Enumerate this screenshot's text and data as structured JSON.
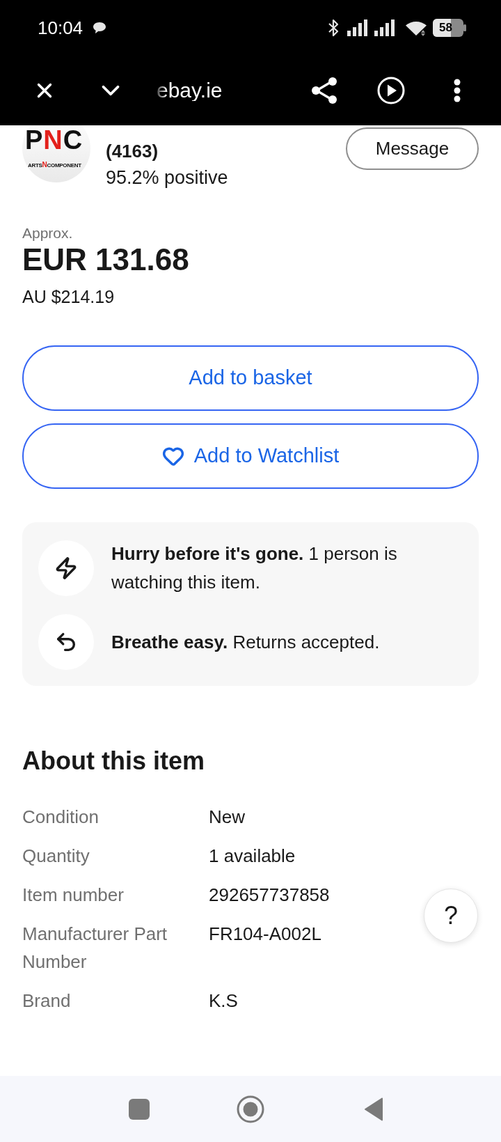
{
  "status_bar": {
    "time": "10:04",
    "battery": "58"
  },
  "browser_toolbar": {
    "url": "ebay.ie"
  },
  "seller": {
    "logo": {
      "letters": [
        {
          "text": "P",
          "color": "#111111"
        },
        {
          "text": "N",
          "color": "#e3201b"
        },
        {
          "text": "C",
          "color": "#111111"
        }
      ],
      "tagline": [
        {
          "text": "ARTS",
          "color": "#111111"
        },
        {
          "text": "N",
          "color": "#e3201b"
        },
        {
          "text": "COMPONENT",
          "color": "#111111"
        }
      ]
    },
    "feedback_count": "(4163)",
    "positive_rating": "95.2% positive",
    "message_button": "Message"
  },
  "price": {
    "note": "Approx.",
    "amount": "EUR 131.68",
    "converted": "AU $214.19"
  },
  "actions": [
    {
      "kind": "basket",
      "label": "Add to basket"
    },
    {
      "kind": "watchlist",
      "label": "Add to Watchlist"
    }
  ],
  "highlights": [
    {
      "kind": "lightning",
      "text": "**Hurry before it's gone.** 1 person is watching this item."
    },
    {
      "kind": "returns",
      "text": "**Breathe easy.** Returns accepted."
    }
  ],
  "about": {
    "title": "About this item",
    "rows": [
      {
        "label": "Condition",
        "value": "New"
      },
      {
        "label": "Quantity",
        "value": "1 available"
      },
      {
        "label": "Item number",
        "value": "292657737858"
      },
      {
        "label": "Manufacturer Part Number",
        "value": "FR104-A002L"
      },
      {
        "label": "Brand",
        "value": "K.S"
      }
    ]
  },
  "help_button": {
    "label": "?"
  }
}
